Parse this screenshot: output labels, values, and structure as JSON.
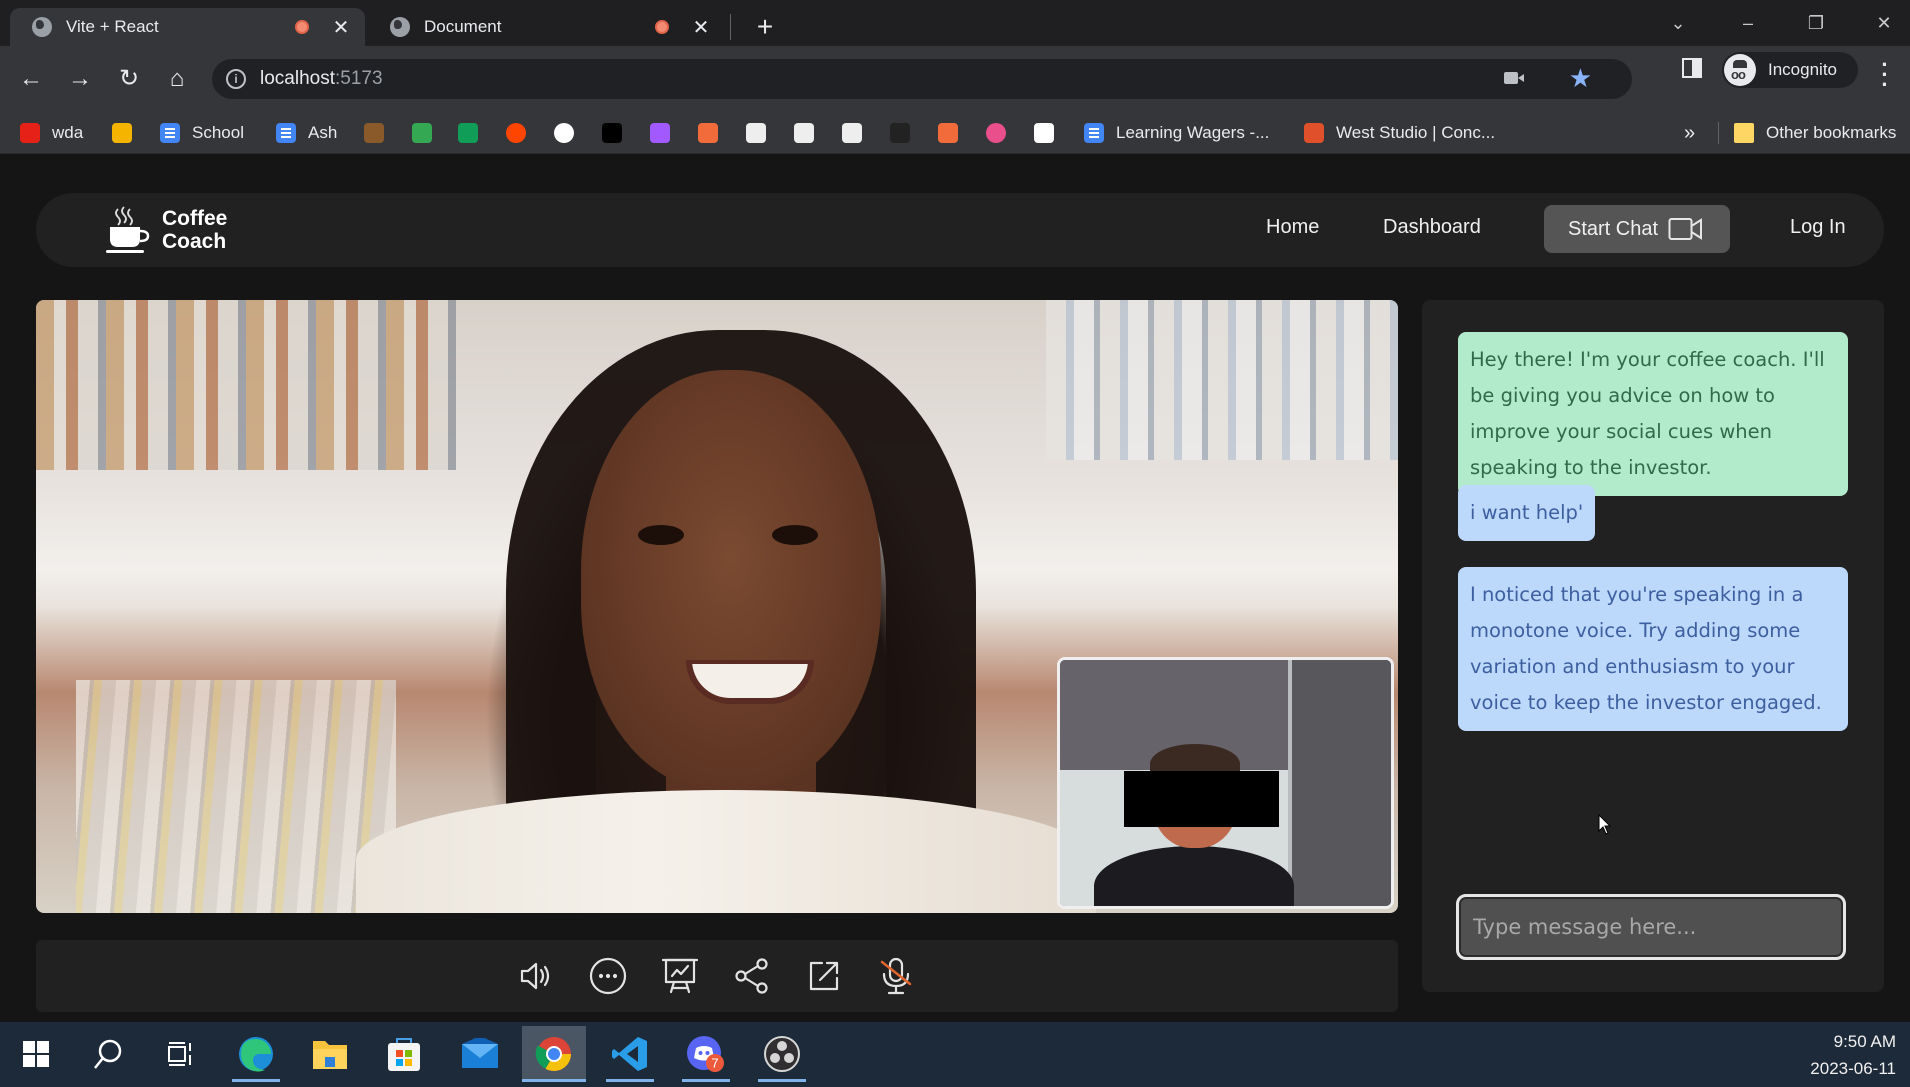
{
  "browser": {
    "tabs": [
      {
        "title": "Vite + React",
        "active": true,
        "recording": true
      },
      {
        "title": "Document",
        "active": false,
        "recording": true
      }
    ],
    "new_tab_icon": "plus-icon",
    "window_controls": [
      "tab-search-icon",
      "minimize-icon",
      "restore-icon",
      "close-icon"
    ],
    "nav": [
      "back-icon",
      "forward-icon",
      "reload-icon",
      "home-icon"
    ],
    "url_host": "localhost",
    "url_port": ":5173",
    "profile_label": "Incognito",
    "bookmarks": [
      {
        "label": "wda",
        "icon": "youtube-icon",
        "color": "#e62117"
      },
      {
        "label": "",
        "icon": "classroom-icon",
        "color": "#f4b400"
      },
      {
        "label": "School",
        "icon": "docs-icon",
        "color": "#4285f4"
      },
      {
        "label": "Ash",
        "icon": "docs-icon",
        "color": "#4285f4"
      },
      {
        "label": "",
        "icon": "bookmark-icon",
        "color": "#8a5a2b"
      },
      {
        "label": "",
        "icon": "drive-icon",
        "color": "#34a853"
      },
      {
        "label": "",
        "icon": "sheets-icon",
        "color": "#0f9d58"
      },
      {
        "label": "",
        "icon": "reddit-icon",
        "color": "#ff4500"
      },
      {
        "label": "",
        "icon": "github-icon",
        "color": "#ffffff"
      },
      {
        "label": "",
        "icon": "replit-icon",
        "color": "#000000"
      },
      {
        "label": "",
        "icon": "figma-icon",
        "color": "#a259ff"
      },
      {
        "label": "",
        "icon": "bookmark-icon",
        "color": "#f26b3a"
      },
      {
        "label": "",
        "icon": "bookmark-icon",
        "color": "#eeeeee"
      },
      {
        "label": "",
        "icon": "bookmark-icon",
        "color": "#eeeeee"
      },
      {
        "label": "",
        "icon": "bookmark-icon",
        "color": "#eeeeee"
      },
      {
        "label": "",
        "icon": "bookmark-icon",
        "color": "#222222"
      },
      {
        "label": "",
        "icon": "bookmark-icon",
        "color": "#f26b3a"
      },
      {
        "label": "",
        "icon": "bookmark-icon",
        "color": "#e94f8a"
      },
      {
        "label": "",
        "icon": "bookmark-icon",
        "color": "#ffffff"
      },
      {
        "label": "Learning Wagers -...",
        "icon": "docs-icon",
        "color": "#4285f4"
      },
      {
        "label": "West Studio | Conc...",
        "icon": "bookmark-icon",
        "color": "#e0502a"
      }
    ],
    "other_bookmarks_label": "Other bookmarks"
  },
  "app": {
    "brand_line1": "Coffee",
    "brand_line2": "Coach",
    "nav": {
      "home": "Home",
      "dashboard": "Dashboard",
      "start_chat": "Start Chat",
      "login": "Log In"
    },
    "controls": [
      {
        "name": "volume",
        "icon": "speaker-icon"
      },
      {
        "name": "more",
        "icon": "more-icon"
      },
      {
        "name": "presentation",
        "icon": "presentation-chart-icon"
      },
      {
        "name": "share",
        "icon": "share-icon"
      },
      {
        "name": "popout",
        "icon": "external-link-icon"
      },
      {
        "name": "microphone",
        "icon": "microphone-muted-icon",
        "muted": true,
        "mute_color": "#e0652e"
      }
    ],
    "chat": {
      "messages": [
        {
          "role": "coach",
          "text": "Hey there! I'm your coffee coach. I'll be giving you advice on how to improve your social cues when speaking to the investor."
        },
        {
          "role": "user",
          "text": "i want help'"
        },
        {
          "role": "coach-feedback",
          "text": "I noticed that you're speaking in a monotone voice. Try adding some variation and enthusiasm to your voice to keep the investor engaged."
        }
      ],
      "input_value": "",
      "input_placeholder": "Type message here...",
      "colors": {
        "coach_bg": "#b2ebcb",
        "coach_text": "#2f6a49",
        "user_bg": "#bcd8fb",
        "user_text": "#3d5fa0"
      }
    }
  },
  "taskbar": {
    "apps": [
      "windows-start-icon",
      "search-icon",
      "task-view-icon",
      "edge-icon",
      "file-explorer-icon",
      "ms-store-icon",
      "mail-icon",
      "chrome-icon",
      "vscode-icon",
      "discord-icon",
      "obs-icon"
    ],
    "active_app": "chrome-icon",
    "discord_badge": "7",
    "time": "9:50 AM",
    "date": "2023-06-11"
  }
}
